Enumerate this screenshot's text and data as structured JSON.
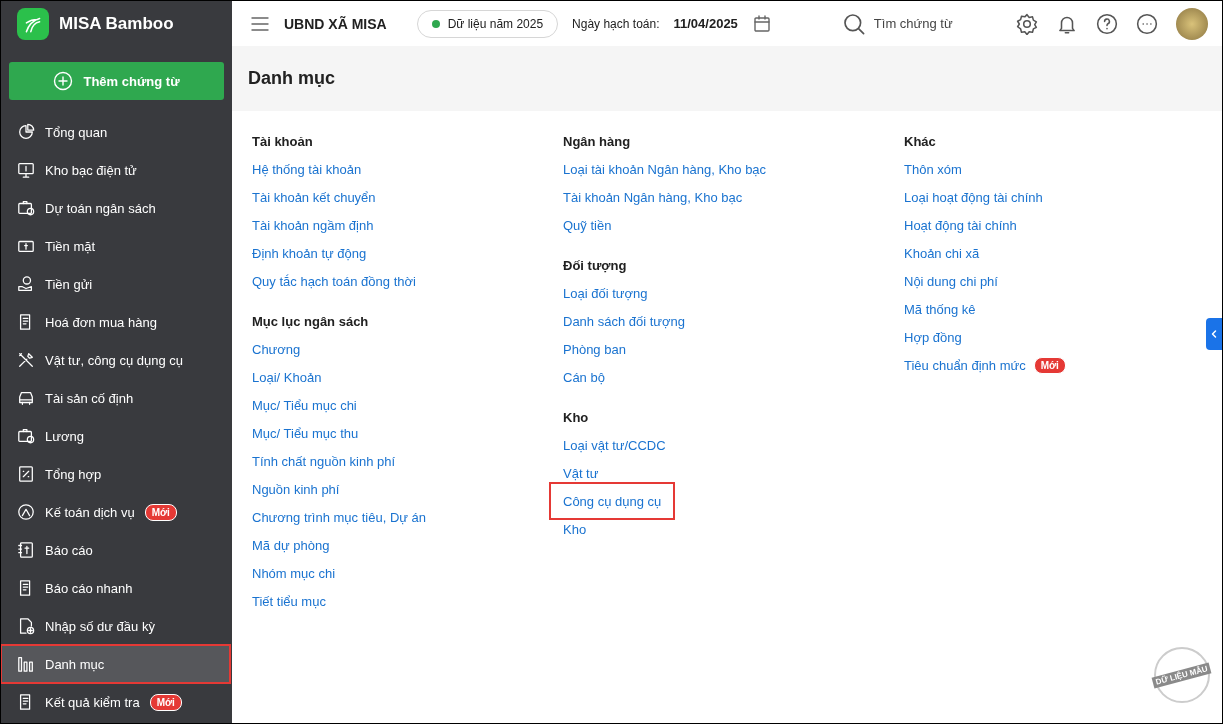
{
  "app": {
    "name": "MISA Bamboo"
  },
  "add_button": {
    "label": "Thêm chứng từ"
  },
  "sidebar": {
    "items": [
      {
        "label": "Tổng quan",
        "selected": false,
        "highlighted": false
      },
      {
        "label": "Kho bạc điện tử",
        "selected": false,
        "highlighted": false
      },
      {
        "label": "Dự toán ngân sách",
        "selected": false,
        "highlighted": false
      },
      {
        "label": "Tiền mặt",
        "selected": false,
        "highlighted": false
      },
      {
        "label": "Tiền gửi",
        "selected": false,
        "highlighted": false
      },
      {
        "label": "Hoá đơn mua hàng",
        "selected": false,
        "highlighted": false
      },
      {
        "label": "Vật tư, công cụ dụng cụ",
        "selected": false,
        "highlighted": false
      },
      {
        "label": "Tài sản cố định",
        "selected": false,
        "highlighted": false
      },
      {
        "label": "Lương",
        "selected": false,
        "highlighted": false
      },
      {
        "label": "Tổng hợp",
        "selected": false,
        "highlighted": false
      },
      {
        "label": "Kế toán dịch vụ",
        "badge": "Mới",
        "selected": false,
        "highlighted": false
      },
      {
        "label": "Báo cáo",
        "selected": false,
        "highlighted": false
      },
      {
        "label": "Báo cáo nhanh",
        "selected": false,
        "highlighted": false
      },
      {
        "label": "Nhập số dư đầu kỳ",
        "selected": false,
        "highlighted": false
      },
      {
        "label": "Danh mục",
        "selected": true,
        "highlighted": true
      },
      {
        "label": "Kết quả kiểm tra",
        "badge": "Mới",
        "selected": false,
        "highlighted": false
      }
    ]
  },
  "topbar": {
    "organization": "UBND XÃ MISA",
    "data_year": "Dữ liệu năm 2025",
    "date_label": "Ngày hạch toán:",
    "date": "11/04/2025",
    "search": {
      "placeholder": "Tìm chứng từ"
    }
  },
  "page_title": "Danh mục",
  "columns": [
    {
      "groups": [
        {
          "title": "Tài khoản",
          "links": [
            {
              "label": "Hệ thống tài khoản",
              "highlighted": false
            },
            {
              "label": "Tài khoản kết chuyển",
              "highlighted": false
            },
            {
              "label": "Tài khoản ngầm định",
              "highlighted": false
            },
            {
              "label": "Định khoản tự động",
              "highlighted": false
            },
            {
              "label": "Quy tắc hạch toán đồng thời",
              "highlighted": false
            }
          ]
        },
        {
          "title": "Mục lục ngân sách",
          "links": [
            {
              "label": "Chương",
              "highlighted": false
            },
            {
              "label": "Loại/ Khoản",
              "highlighted": false
            },
            {
              "label": "Mục/ Tiểu mục chi",
              "highlighted": false
            },
            {
              "label": "Mục/ Tiểu mục thu",
              "highlighted": false
            },
            {
              "label": "Tính chất nguồn kinh phí",
              "highlighted": false
            },
            {
              "label": "Nguồn kinh phí",
              "highlighted": false
            },
            {
              "label": "Chương trình mục tiêu, Dự án",
              "highlighted": false
            },
            {
              "label": "Mã dự phòng",
              "highlighted": false
            },
            {
              "label": "Nhóm mục chi",
              "highlighted": false
            },
            {
              "label": "Tiết tiểu mục",
              "highlighted": false
            }
          ]
        }
      ]
    },
    {
      "groups": [
        {
          "title": "Ngân hàng",
          "links": [
            {
              "label": "Loại tài khoản Ngân hàng, Kho bạc",
              "highlighted": false
            },
            {
              "label": "Tài khoản Ngân hàng, Kho bạc",
              "highlighted": false
            },
            {
              "label": "Quỹ tiền",
              "highlighted": false
            }
          ]
        },
        {
          "title": "Đối tượng",
          "links": [
            {
              "label": "Loại đối tượng",
              "highlighted": false
            },
            {
              "label": "Danh sách đối tượng",
              "highlighted": false
            },
            {
              "label": "Phòng ban",
              "highlighted": false
            },
            {
              "label": "Cán bộ",
              "highlighted": false
            }
          ]
        },
        {
          "title": "Kho",
          "links": [
            {
              "label": "Loại vật tư/CCDC",
              "highlighted": false
            },
            {
              "label": "Vật tư",
              "highlighted": false
            },
            {
              "label": "Công cụ dụng cụ",
              "highlighted": true
            },
            {
              "label": "Kho",
              "highlighted": false
            }
          ]
        }
      ]
    },
    {
      "groups": [
        {
          "title": "Khác",
          "links": [
            {
              "label": "Thôn xóm",
              "highlighted": false
            },
            {
              "label": "Loại hoạt động tài chính",
              "highlighted": false
            },
            {
              "label": "Hoạt động tài chính",
              "highlighted": false
            },
            {
              "label": "Khoản chi xã",
              "highlighted": false
            },
            {
              "label": "Nội dung chi phí",
              "highlighted": false
            },
            {
              "label": "Mã thống kê",
              "highlighted": false
            },
            {
              "label": "Hợp đồng",
              "highlighted": false
            },
            {
              "label": "Tiêu chuẩn định mức",
              "badge": "Mới",
              "highlighted": false
            }
          ]
        }
      ]
    }
  ],
  "stamp": "DỮ LIỆU MẪU"
}
